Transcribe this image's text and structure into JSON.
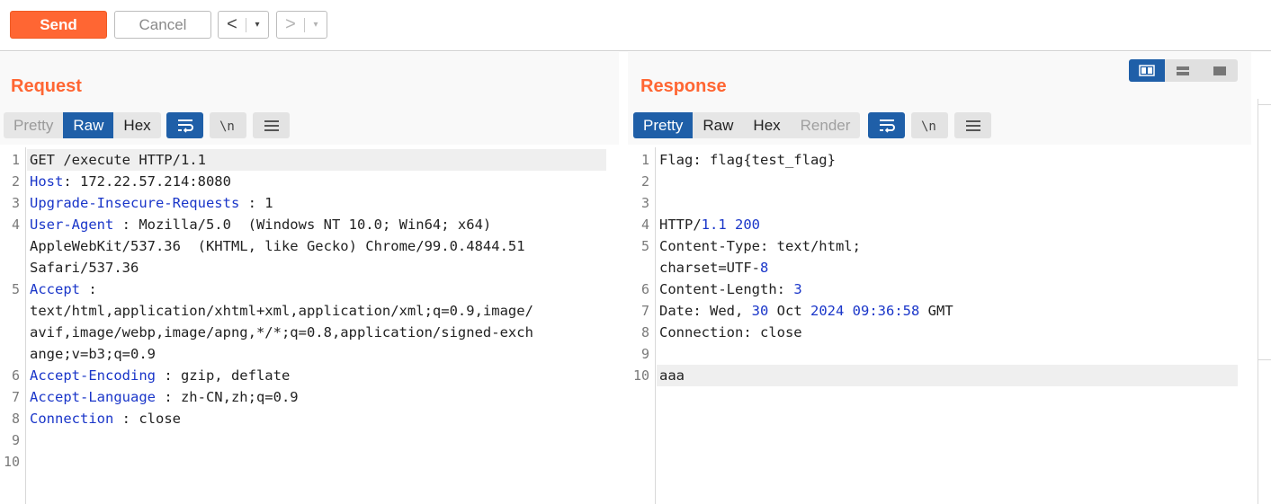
{
  "toolbar": {
    "send_label": "Send",
    "cancel_label": "Cancel",
    "back_glyph": "<",
    "forward_glyph": ">",
    "dropdown_glyph": "▾"
  },
  "request": {
    "title": "Request",
    "tabs": [
      "Pretty",
      "Raw",
      "Hex"
    ],
    "active_tab": "Raw",
    "line_numbers": [
      "1",
      "2",
      "3",
      "4",
      "5",
      "6",
      "7",
      "8",
      "9",
      "10"
    ],
    "lines": {
      "l1": "GET /execute HTTP/1.1",
      "l2_name": "Host",
      "l2_val": ": 172.22.57.214:8080",
      "l3_name": "Upgrade-Insecure-Requests",
      "l3_val": " : 1",
      "l4_name": "User-Agent",
      "l4_val": " : Mozilla/5.0  (Windows NT 10.0; Win64; x64)",
      "l4_cont1": "AppleWebKit/537.36  (KHTML, like Gecko) Chrome/99.0.4844.51",
      "l4_cont2": "Safari/537.36",
      "l5_name": "Accept",
      "l5_val": " :",
      "l5_cont1": "text/html,application/xhtml+xml,application/xml;q=0.9,image/",
      "l5_cont2": "avif,image/webp,image/apng,*/*;q=0.8,application/signed-exch",
      "l5_cont3": "ange;v=b3;q=0.9",
      "l6_name": "Accept-Encoding",
      "l6_val": " : gzip, deflate",
      "l7_name": "Accept-Language",
      "l7_val": " : zh-CN,zh;q=0.9",
      "l8_name": "Connection",
      "l8_val": " : close"
    }
  },
  "response": {
    "title": "Response",
    "tabs": [
      "Pretty",
      "Raw",
      "Hex",
      "Render"
    ],
    "active_tab": "Pretty",
    "line_numbers": [
      "1",
      "2",
      "3",
      "4",
      "5",
      "6",
      "7",
      "8",
      "9",
      "10"
    ],
    "lines": {
      "l1": "Flag: flag{test_flag}",
      "l4_a": "HTTP/",
      "l4_b": "1.1 200",
      "l5_a": "Content-Type: text/html;",
      "l5_cont_a": "charset=UTF-",
      "l5_cont_b": "8",
      "l6_a": "Content-Length: ",
      "l6_b": "3",
      "l7_a": "Date: Wed, ",
      "l7_b": "30",
      "l7_c": " Oct ",
      "l7_d": "2024 09:36:58",
      "l7_e": " GMT",
      "l8": "Connection: close",
      "l10": "aaa"
    }
  },
  "colors": {
    "accent_orange": "#ff6633",
    "active_blue": "#1f5fa8",
    "header_blue": "#1a36c9"
  },
  "icons": [
    "wrap-lines-icon",
    "newline-icon",
    "menu-icon",
    "layout-side-by-side-icon",
    "layout-stacked-icon",
    "layout-single-icon"
  ]
}
